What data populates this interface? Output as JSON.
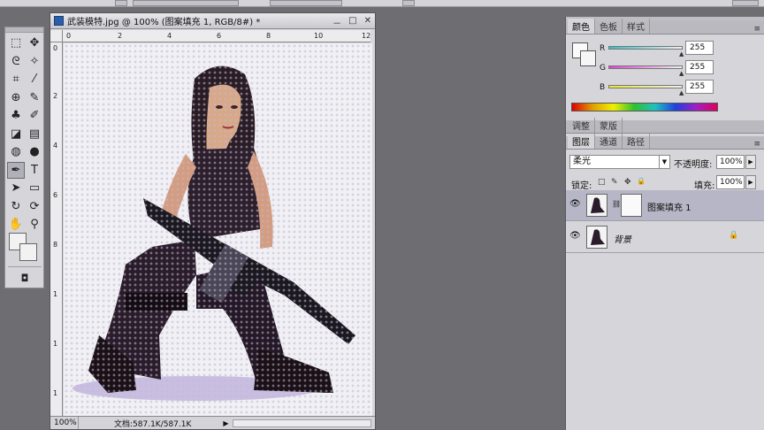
{
  "document": {
    "title": "武装模特.jpg @ 100% (图案填充 1, RGB/8#) *",
    "win_buttons": [
      "－",
      "□",
      "✕"
    ],
    "ruler_h": [
      "0",
      "2",
      "4",
      "6",
      "8",
      "10",
      "12"
    ],
    "ruler_v": [
      "0",
      "2",
      "4",
      "6",
      "8",
      "1",
      "1",
      "1"
    ],
    "zoom": "100%",
    "doc_size": "文档:587.1K/587.1K",
    "arrow": "▶"
  },
  "toolbox": {
    "tools": [
      {
        "name": "marquee-tool",
        "glyph": "⬚"
      },
      {
        "name": "move-tool",
        "glyph": "✥"
      },
      {
        "name": "lasso-tool",
        "glyph": "ᘓ"
      },
      {
        "name": "magic-wand-tool",
        "glyph": "✧"
      },
      {
        "name": "crop-tool",
        "glyph": "⌗"
      },
      {
        "name": "eyedropper-tool",
        "glyph": "⁄"
      },
      {
        "name": "healing-tool",
        "glyph": "⊕"
      },
      {
        "name": "brush-tool",
        "glyph": "✎"
      },
      {
        "name": "stamp-tool",
        "glyph": "♣"
      },
      {
        "name": "history-brush-tool",
        "glyph": "✐"
      },
      {
        "name": "eraser-tool",
        "glyph": "◪"
      },
      {
        "name": "gradient-tool",
        "glyph": "▤"
      },
      {
        "name": "blur-tool",
        "glyph": "◍"
      },
      {
        "name": "dodge-tool",
        "glyph": "●"
      },
      {
        "name": "pen-tool",
        "glyph": "✒"
      },
      {
        "name": "type-tool",
        "glyph": "T"
      },
      {
        "name": "path-select-tool",
        "glyph": "➤"
      },
      {
        "name": "shape-tool",
        "glyph": "▭"
      },
      {
        "name": "3d-rotate-tool",
        "glyph": "↻"
      },
      {
        "name": "3d-orbit-tool",
        "glyph": "⟳"
      },
      {
        "name": "hand-tool",
        "glyph": "✋"
      },
      {
        "name": "zoom-tool",
        "glyph": "⚲"
      }
    ],
    "quickmask": "◘"
  },
  "color_panel": {
    "tabs": [
      "颜色",
      "色板",
      "样式"
    ],
    "channels": [
      {
        "label": "R",
        "value": "255",
        "color": "#30d8e0"
      },
      {
        "label": "G",
        "value": "255",
        "color": "#e040d8"
      },
      {
        "label": "B",
        "value": "255",
        "color": "#e8e830"
      }
    ]
  },
  "adjust_tabs": [
    "调整",
    "蒙版"
  ],
  "layers_panel": {
    "tabs": [
      "图层",
      "通道",
      "路径"
    ],
    "blend_mode": "柔光",
    "opacity_label": "不透明度:",
    "opacity": "100%",
    "lock_label": "锁定:",
    "lock_icons": [
      "□",
      "✎",
      "✥",
      "🔒"
    ],
    "fill_label": "填充:",
    "fill": "100%",
    "layers": [
      {
        "name": "图案填充 1",
        "selected": true,
        "italic": false
      },
      {
        "name": "背景",
        "selected": false,
        "italic": true
      }
    ],
    "lock_glyph": "🔒"
  },
  "panel_menu_icon": "≡"
}
